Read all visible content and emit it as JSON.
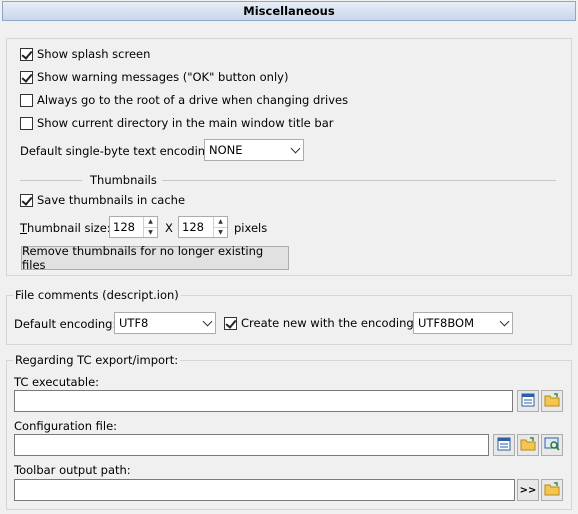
{
  "header": {
    "title": "Miscellaneous"
  },
  "general": {
    "show_splash": {
      "label": "Show splash screen",
      "checked": true
    },
    "show_warnings": {
      "label": "Show warning messages (\"OK\" button only)",
      "checked": true
    },
    "root_drive": {
      "label": "Always go to the root of a drive when changing drives",
      "checked": false
    },
    "show_cur_dir": {
      "label": "Show current directory in the main window title bar",
      "checked": false
    },
    "encoding_label": "Default single-byte text encoding:",
    "encoding_value": "NONE"
  },
  "thumbnails": {
    "title": "Thumbnails",
    "save_cache": {
      "label": "Save thumbnails in cache",
      "checked": true
    },
    "size_label_prefix": "T",
    "size_label_rest": "humbnail size:",
    "width": "128",
    "x_label": "X",
    "height": "128",
    "units": "pixels",
    "remove_button": "Remove thumbnails for no longer existing files"
  },
  "comments": {
    "title": "File comments (descript.ion)",
    "default_label": "Default encoding:",
    "default_value": "UTF8",
    "create_new": {
      "label": "Create new with the encoding:",
      "checked": true
    },
    "create_value": "UTF8BOM"
  },
  "tc": {
    "title": "Regarding TC export/import:",
    "exe_label": "TC executable:",
    "exe_value": "",
    "config_label": "Configuration file:",
    "config_value": "",
    "toolbar_label": "Toolbar output path:",
    "toolbar_value": "",
    "browse_label": ">>"
  }
}
